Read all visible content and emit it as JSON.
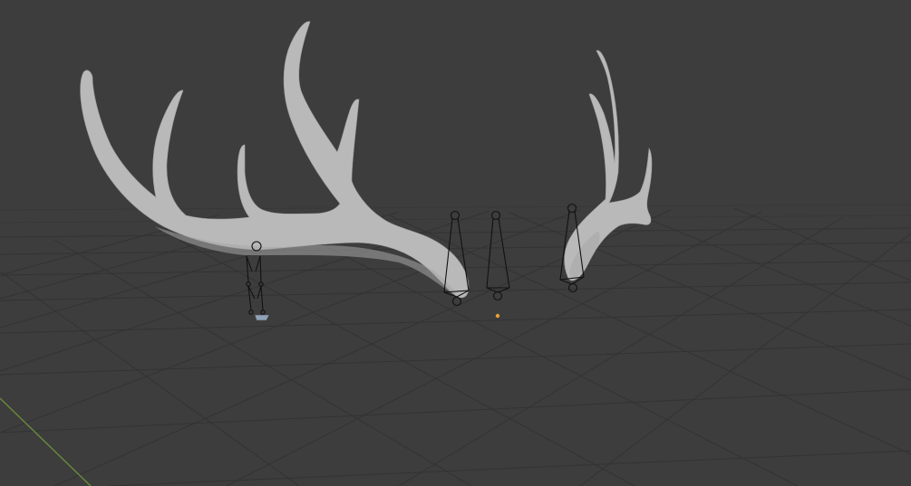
{
  "viewport": {
    "background_color": "#3d3d3d",
    "grid_color": "#333333",
    "x_axis_color": "#6a8a3a",
    "mesh_color": "#b9b9b9",
    "armature_color": "#111111",
    "origin_color": "#e8a030"
  },
  "objects": [
    {
      "name": "left-antler-mesh",
      "type": "mesh"
    },
    {
      "name": "right-antler-mesh",
      "type": "mesh"
    },
    {
      "name": "bone-chain-armature",
      "type": "armature"
    },
    {
      "name": "octahedral-bone-1",
      "type": "bone"
    },
    {
      "name": "octahedral-bone-2",
      "type": "bone"
    },
    {
      "name": "octahedral-bone-3",
      "type": "bone"
    },
    {
      "name": "selected-object-origin",
      "type": "origin"
    }
  ]
}
